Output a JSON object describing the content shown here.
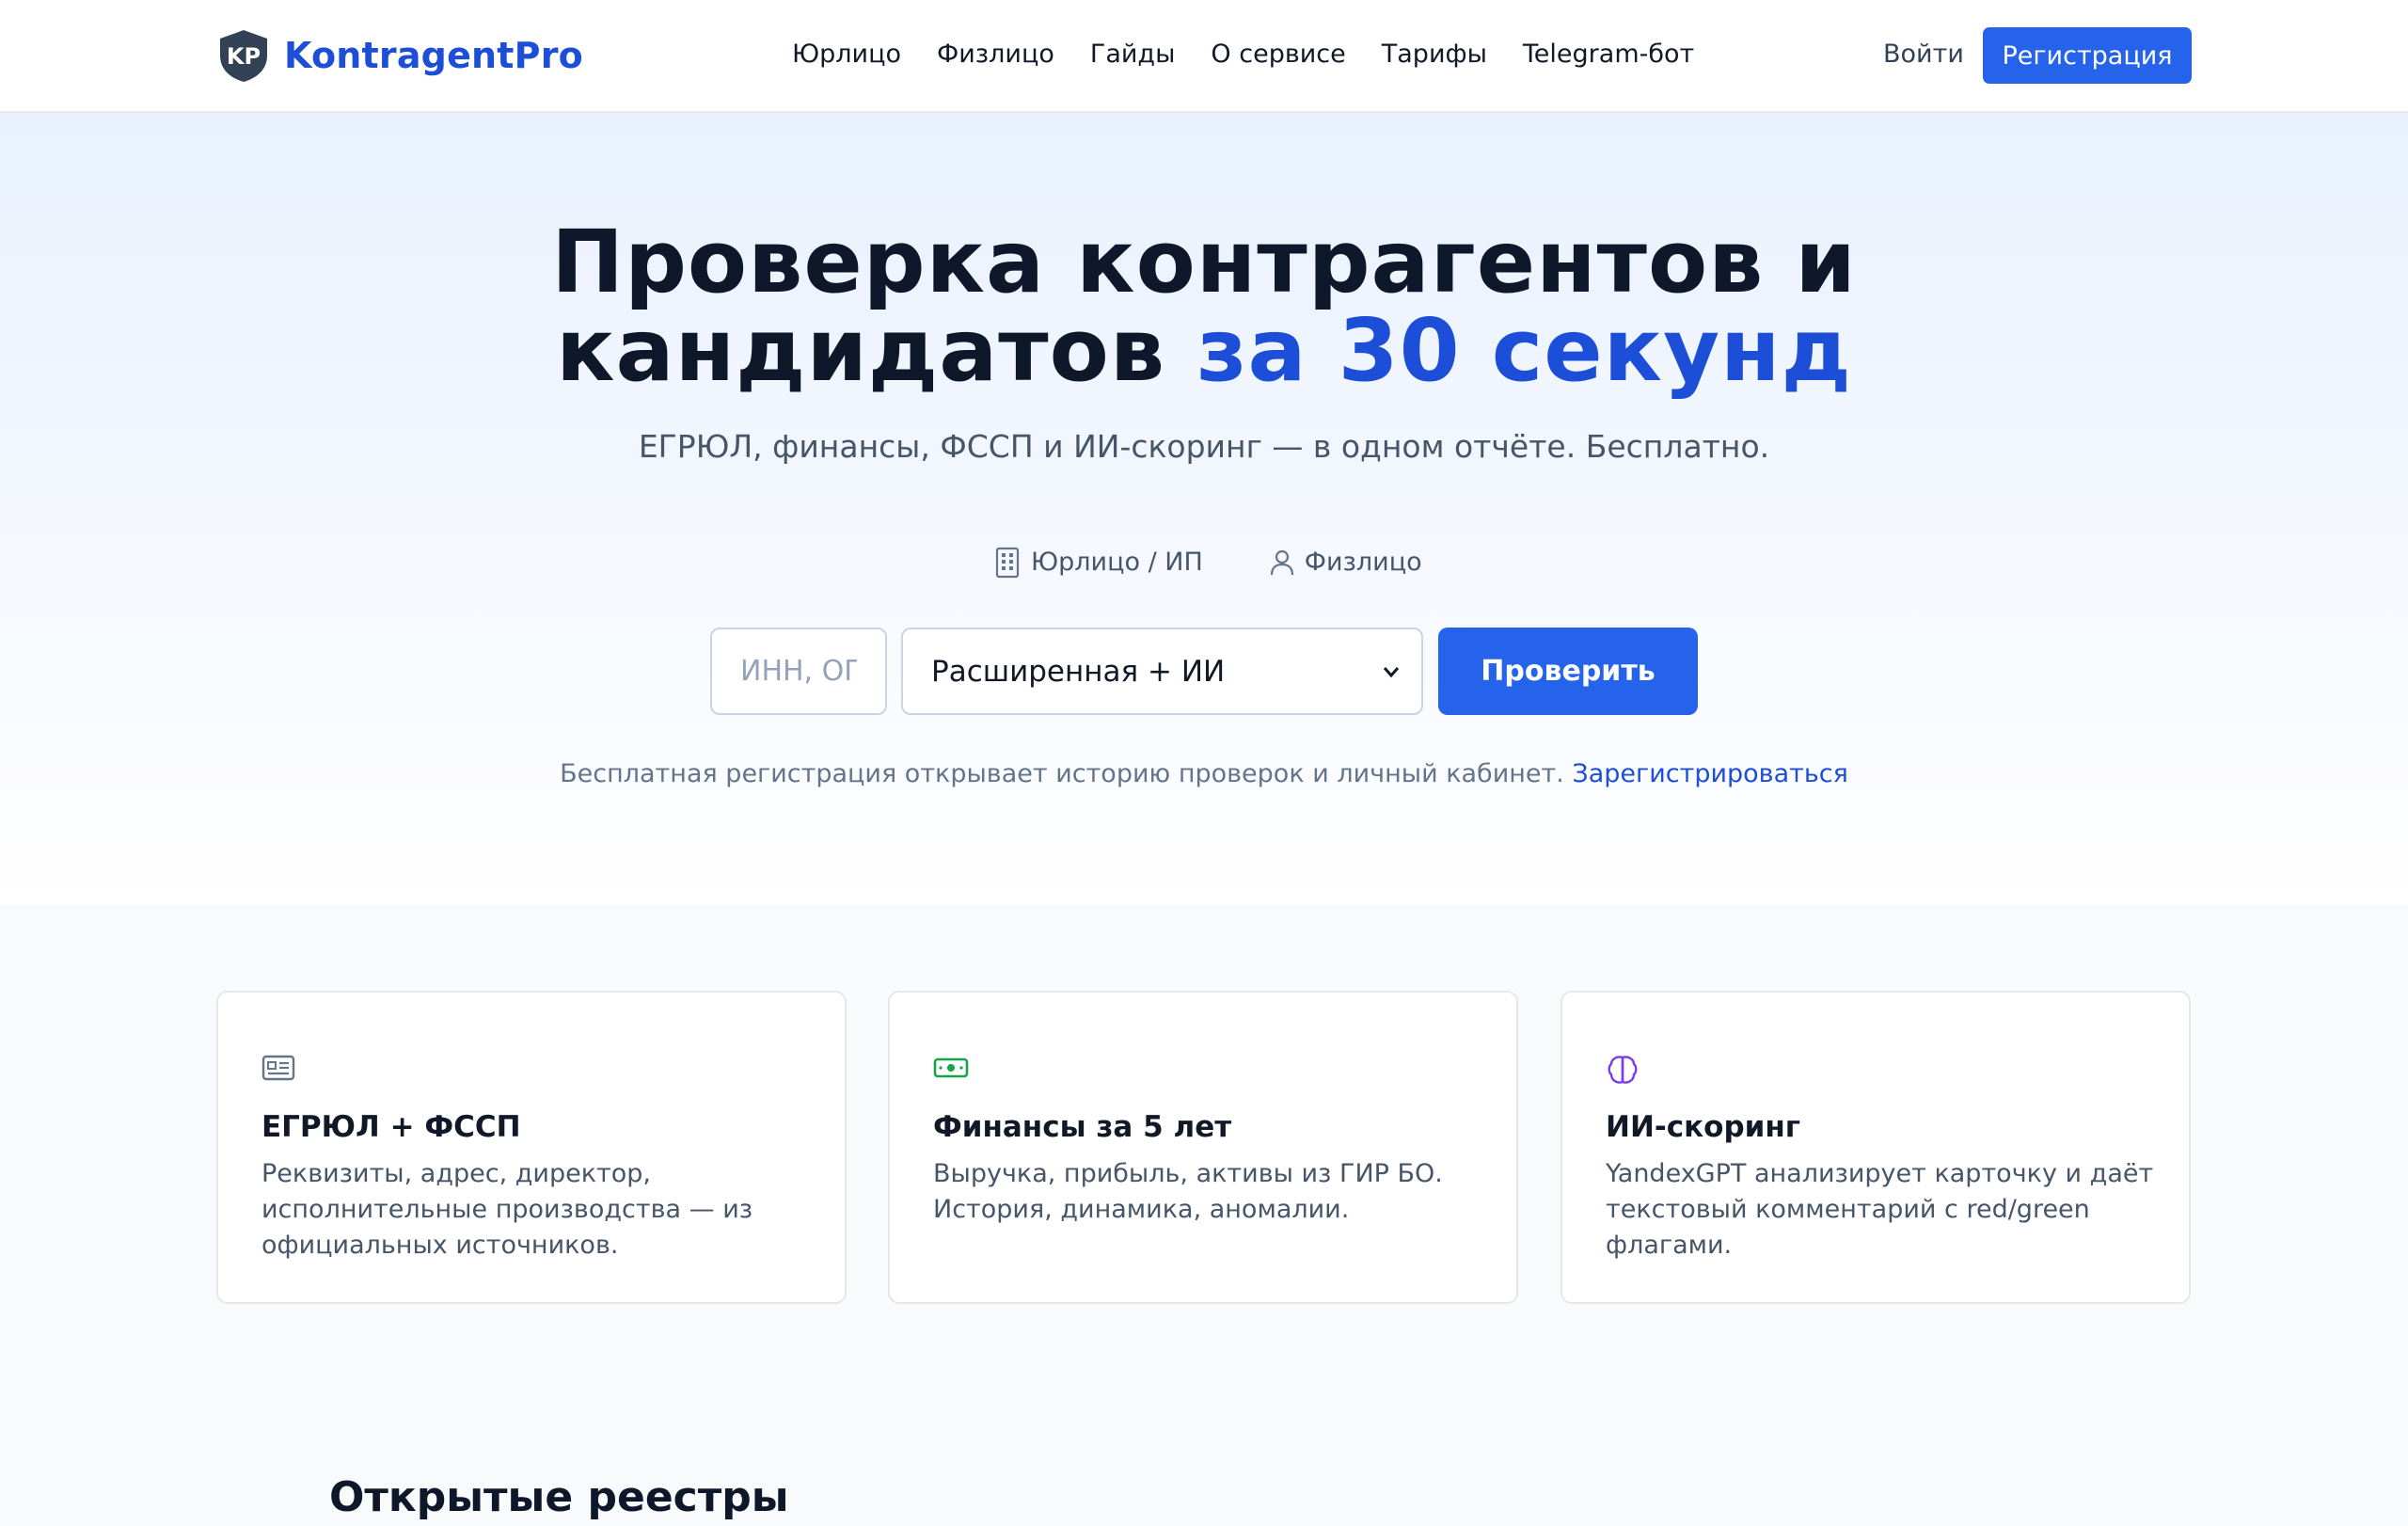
{
  "header": {
    "logo_text": "KontragentPro",
    "nav": [
      "Юрлицо",
      "Физлицо",
      "Гайды",
      "О сервисе",
      "Тарифы",
      "Telegram-бот"
    ],
    "login": "Войти",
    "register": "Регистрация"
  },
  "hero": {
    "title_line1": "Проверка контрагентов и",
    "title_line2_plain": "кандидатов ",
    "title_line2_accent": "за 30 секунд",
    "subtitle": "ЕГРЮЛ, финансы, ФССП и ИИ-скоринг — в одном отчёте. Бесплатно.",
    "tabs": [
      {
        "label": "Юрлицо / ИП",
        "icon": "building-icon"
      },
      {
        "label": "Физлицо",
        "icon": "person-icon"
      }
    ],
    "input_placeholder": "ИНН, ОГ",
    "select_value": "Расширенная + ИИ",
    "check_button": "Проверить",
    "note_text": "Бесплатная регистрация открывает историю проверок и личный кабинет. ",
    "note_link": "Зарегистрироваться"
  },
  "features": [
    {
      "icon": "id-card-icon",
      "title": "ЕГРЮЛ + ФССП",
      "text": "Реквизиты, адрес, директор, исполнительные производства — из официальных источников."
    },
    {
      "icon": "banknote-icon",
      "title": "Финансы за 5 лет",
      "text": "Выручка, прибыль, активы из ГИР БО. История, динамика, аномалии."
    },
    {
      "icon": "brain-icon",
      "title": "ИИ-скоринг",
      "text": "YandexGPT анализирует карточку и даёт текстовый комментарий с red/green флагами."
    }
  ],
  "registries_title": "Открытые реестры",
  "colors": {
    "accent": "#1d4ed8",
    "primary_button": "#2563eb",
    "green_icon": "#16a34a",
    "purple_icon": "#7c3aed"
  }
}
